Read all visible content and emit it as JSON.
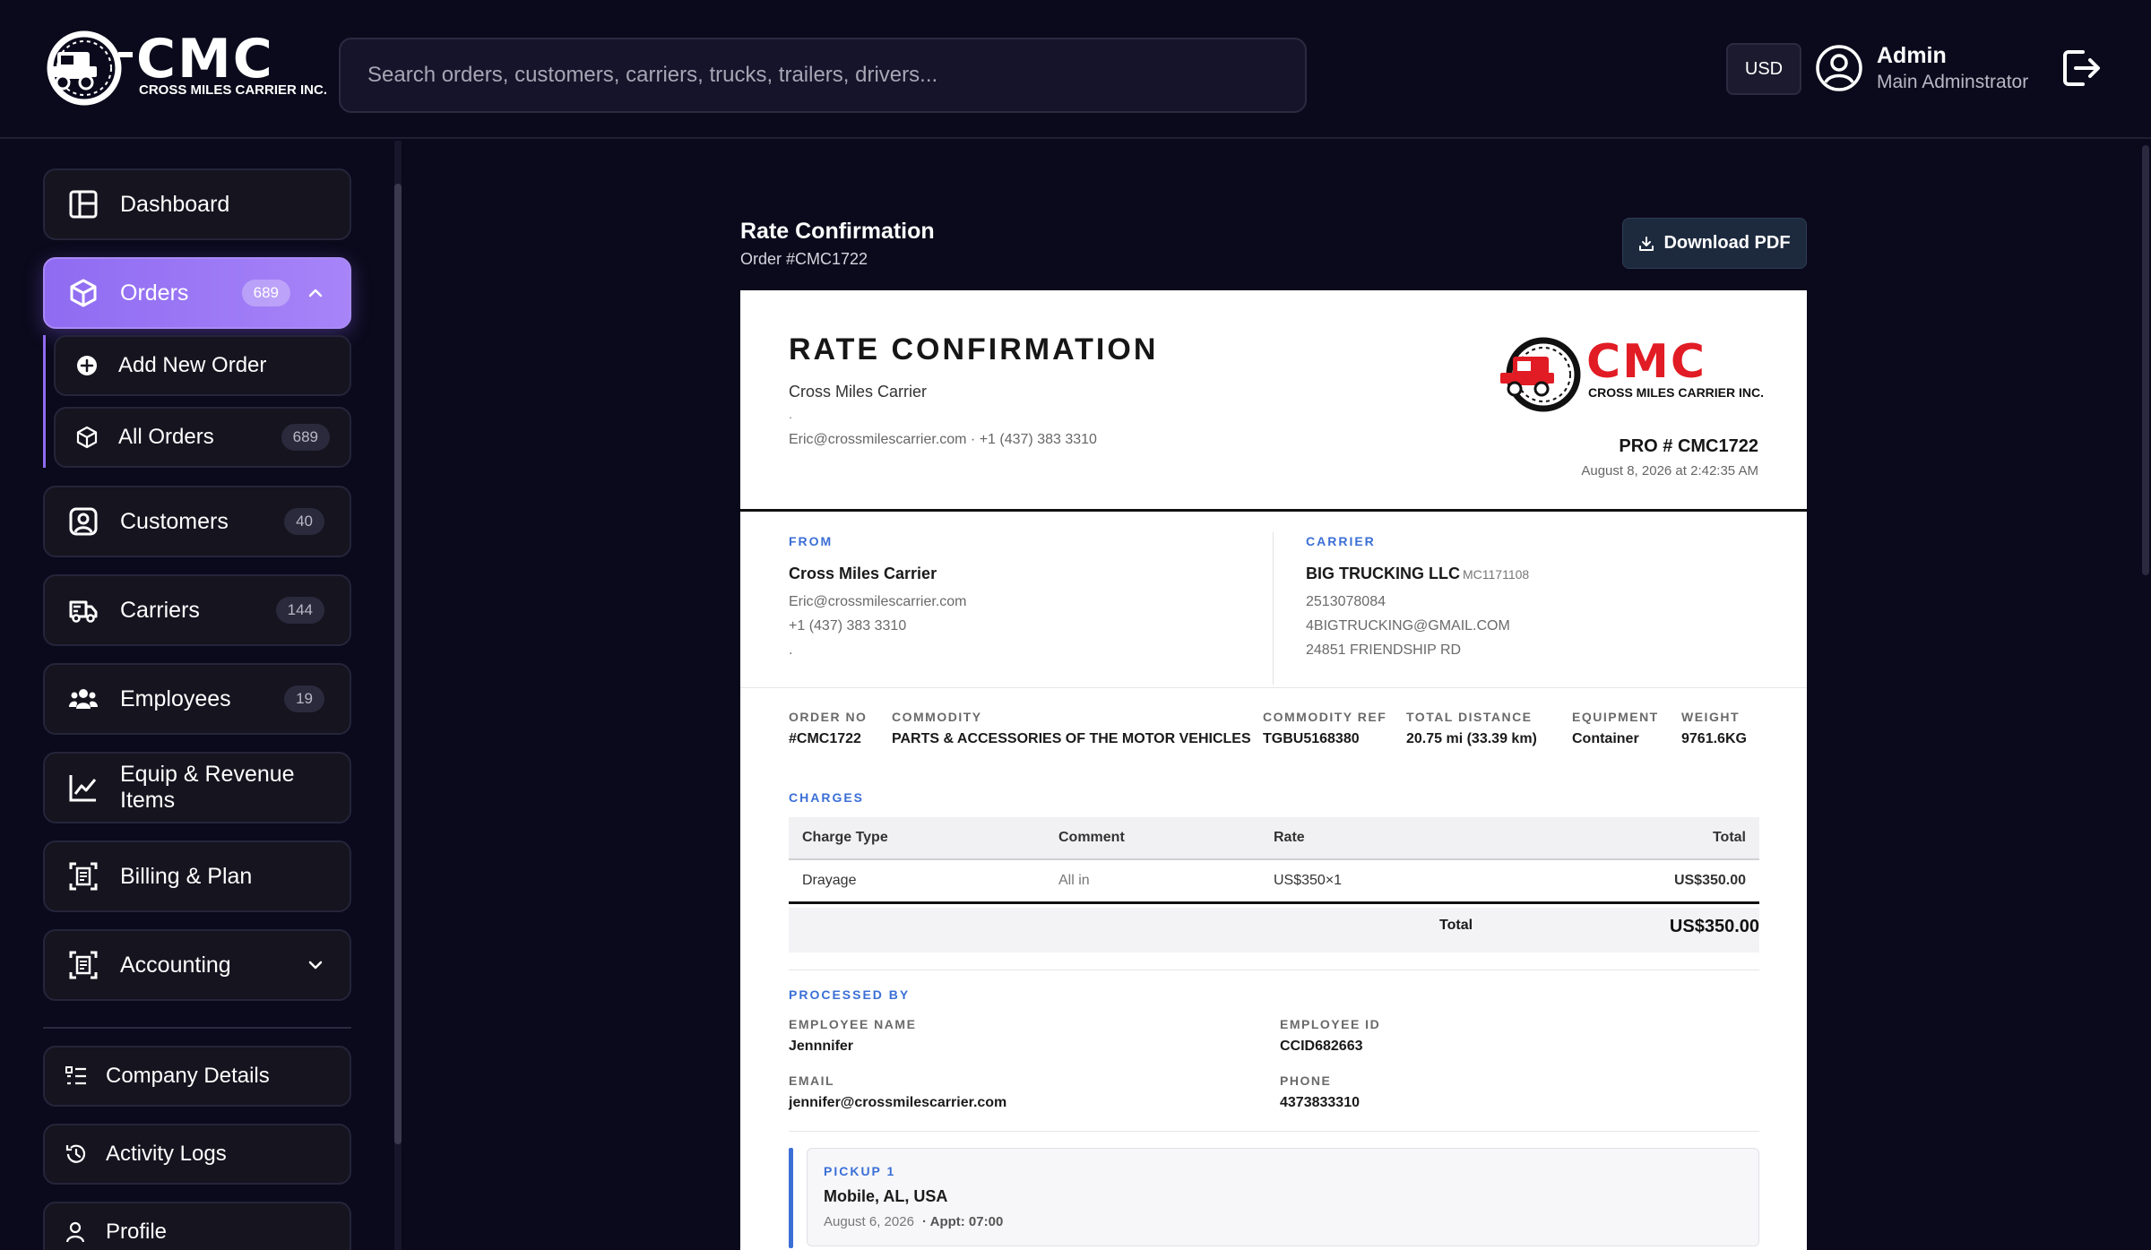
{
  "header": {
    "logo_brand": "CMC",
    "logo_subtitle": "CROSS MILES CARRIER INC.",
    "search_placeholder": "Search orders, customers, carriers, trucks, trailers, drivers...",
    "currency": "USD",
    "user_name": "Admin",
    "user_role": "Main Adminstrator"
  },
  "sidebar": {
    "dashboard": "Dashboard",
    "orders": {
      "label": "Orders",
      "count": "689"
    },
    "add_new_order": "Add New Order",
    "all_orders": {
      "label": "All Orders",
      "count": "689"
    },
    "customers": {
      "label": "Customers",
      "count": "40"
    },
    "carriers": {
      "label": "Carriers",
      "count": "144"
    },
    "employees": {
      "label": "Employees",
      "count": "19"
    },
    "equip_revenue": "Equip & Revenue Items",
    "billing": "Billing & Plan",
    "accounting": "Accounting",
    "company_details": "Company Details",
    "activity_logs": "Activity Logs",
    "profile": "Profile"
  },
  "page": {
    "title": "Rate Confirmation",
    "order_ref": "Order #CMC1722",
    "download_label": "Download PDF"
  },
  "document": {
    "heading": "RATE CONFIRMATION",
    "company": "Cross Miles Carrier",
    "company_dot": ".",
    "contact": "Eric@crossmilescarrier.com · +1 (437) 383 3310",
    "logo_brand": "CMC",
    "logo_subtitle": "CROSS MILES CARRIER INC.",
    "pro": "PRO # CMC1722",
    "date": "August 8, 2026 at 2:42:35 AM",
    "from": {
      "label": "FROM",
      "name": "Cross Miles Carrier",
      "email": "Eric@crossmilescarrier.com",
      "phone": "+1 (437) 383 3310",
      "extra": "."
    },
    "carrier": {
      "label": "CARRIER",
      "name": "BIG TRUCKING LLC",
      "mc": "MC1171108",
      "phone": "2513078084",
      "email": "4BIGTRUCKING@GMAIL.COM",
      "address": "24851 FRIENDSHIP RD"
    },
    "meta": [
      {
        "label": "ORDER NO",
        "value": "#CMC1722"
      },
      {
        "label": "COMMODITY",
        "value": "PARTS & ACCESSORIES OF THE MOTOR VEHICLES"
      },
      {
        "label": "COMMODITY REF",
        "value": "TGBU5168380"
      },
      {
        "label": "TOTAL DISTANCE",
        "value": "20.75 mi (33.39 km)"
      },
      {
        "label": "EQUIPMENT",
        "value": "Container"
      },
      {
        "label": "WEIGHT",
        "value": "9761.6KG"
      }
    ],
    "charges": {
      "label": "CHARGES",
      "headers": [
        "Charge Type",
        "Comment",
        "Rate",
        "Total"
      ],
      "rows": [
        {
          "type": "Drayage",
          "comment": "All in",
          "rate": "US$350×1",
          "total": "US$350.00"
        }
      ],
      "total_label": "Total",
      "total_value": "US$350.00"
    },
    "processed": {
      "label": "PROCESSED BY",
      "employee_name_label": "EMPLOYEE NAME",
      "employee_name": "Jennnifer",
      "employee_id_label": "EMPLOYEE ID",
      "employee_id": "CCID682663",
      "email_label": "EMAIL",
      "email": "jennifer@crossmilescarrier.com",
      "phone_label": "PHONE",
      "phone": "4373833310"
    },
    "pickup": {
      "label": "PICKUP 1",
      "location": "Mobile, AL, USA",
      "date": "August 6, 2026",
      "appt": "· Appt: 07:00"
    }
  },
  "colors": {
    "background": "#0b0a1c",
    "accent": "#9b77f4",
    "doc_label": "#3b6fd6",
    "logo_red": "#e11c24"
  }
}
